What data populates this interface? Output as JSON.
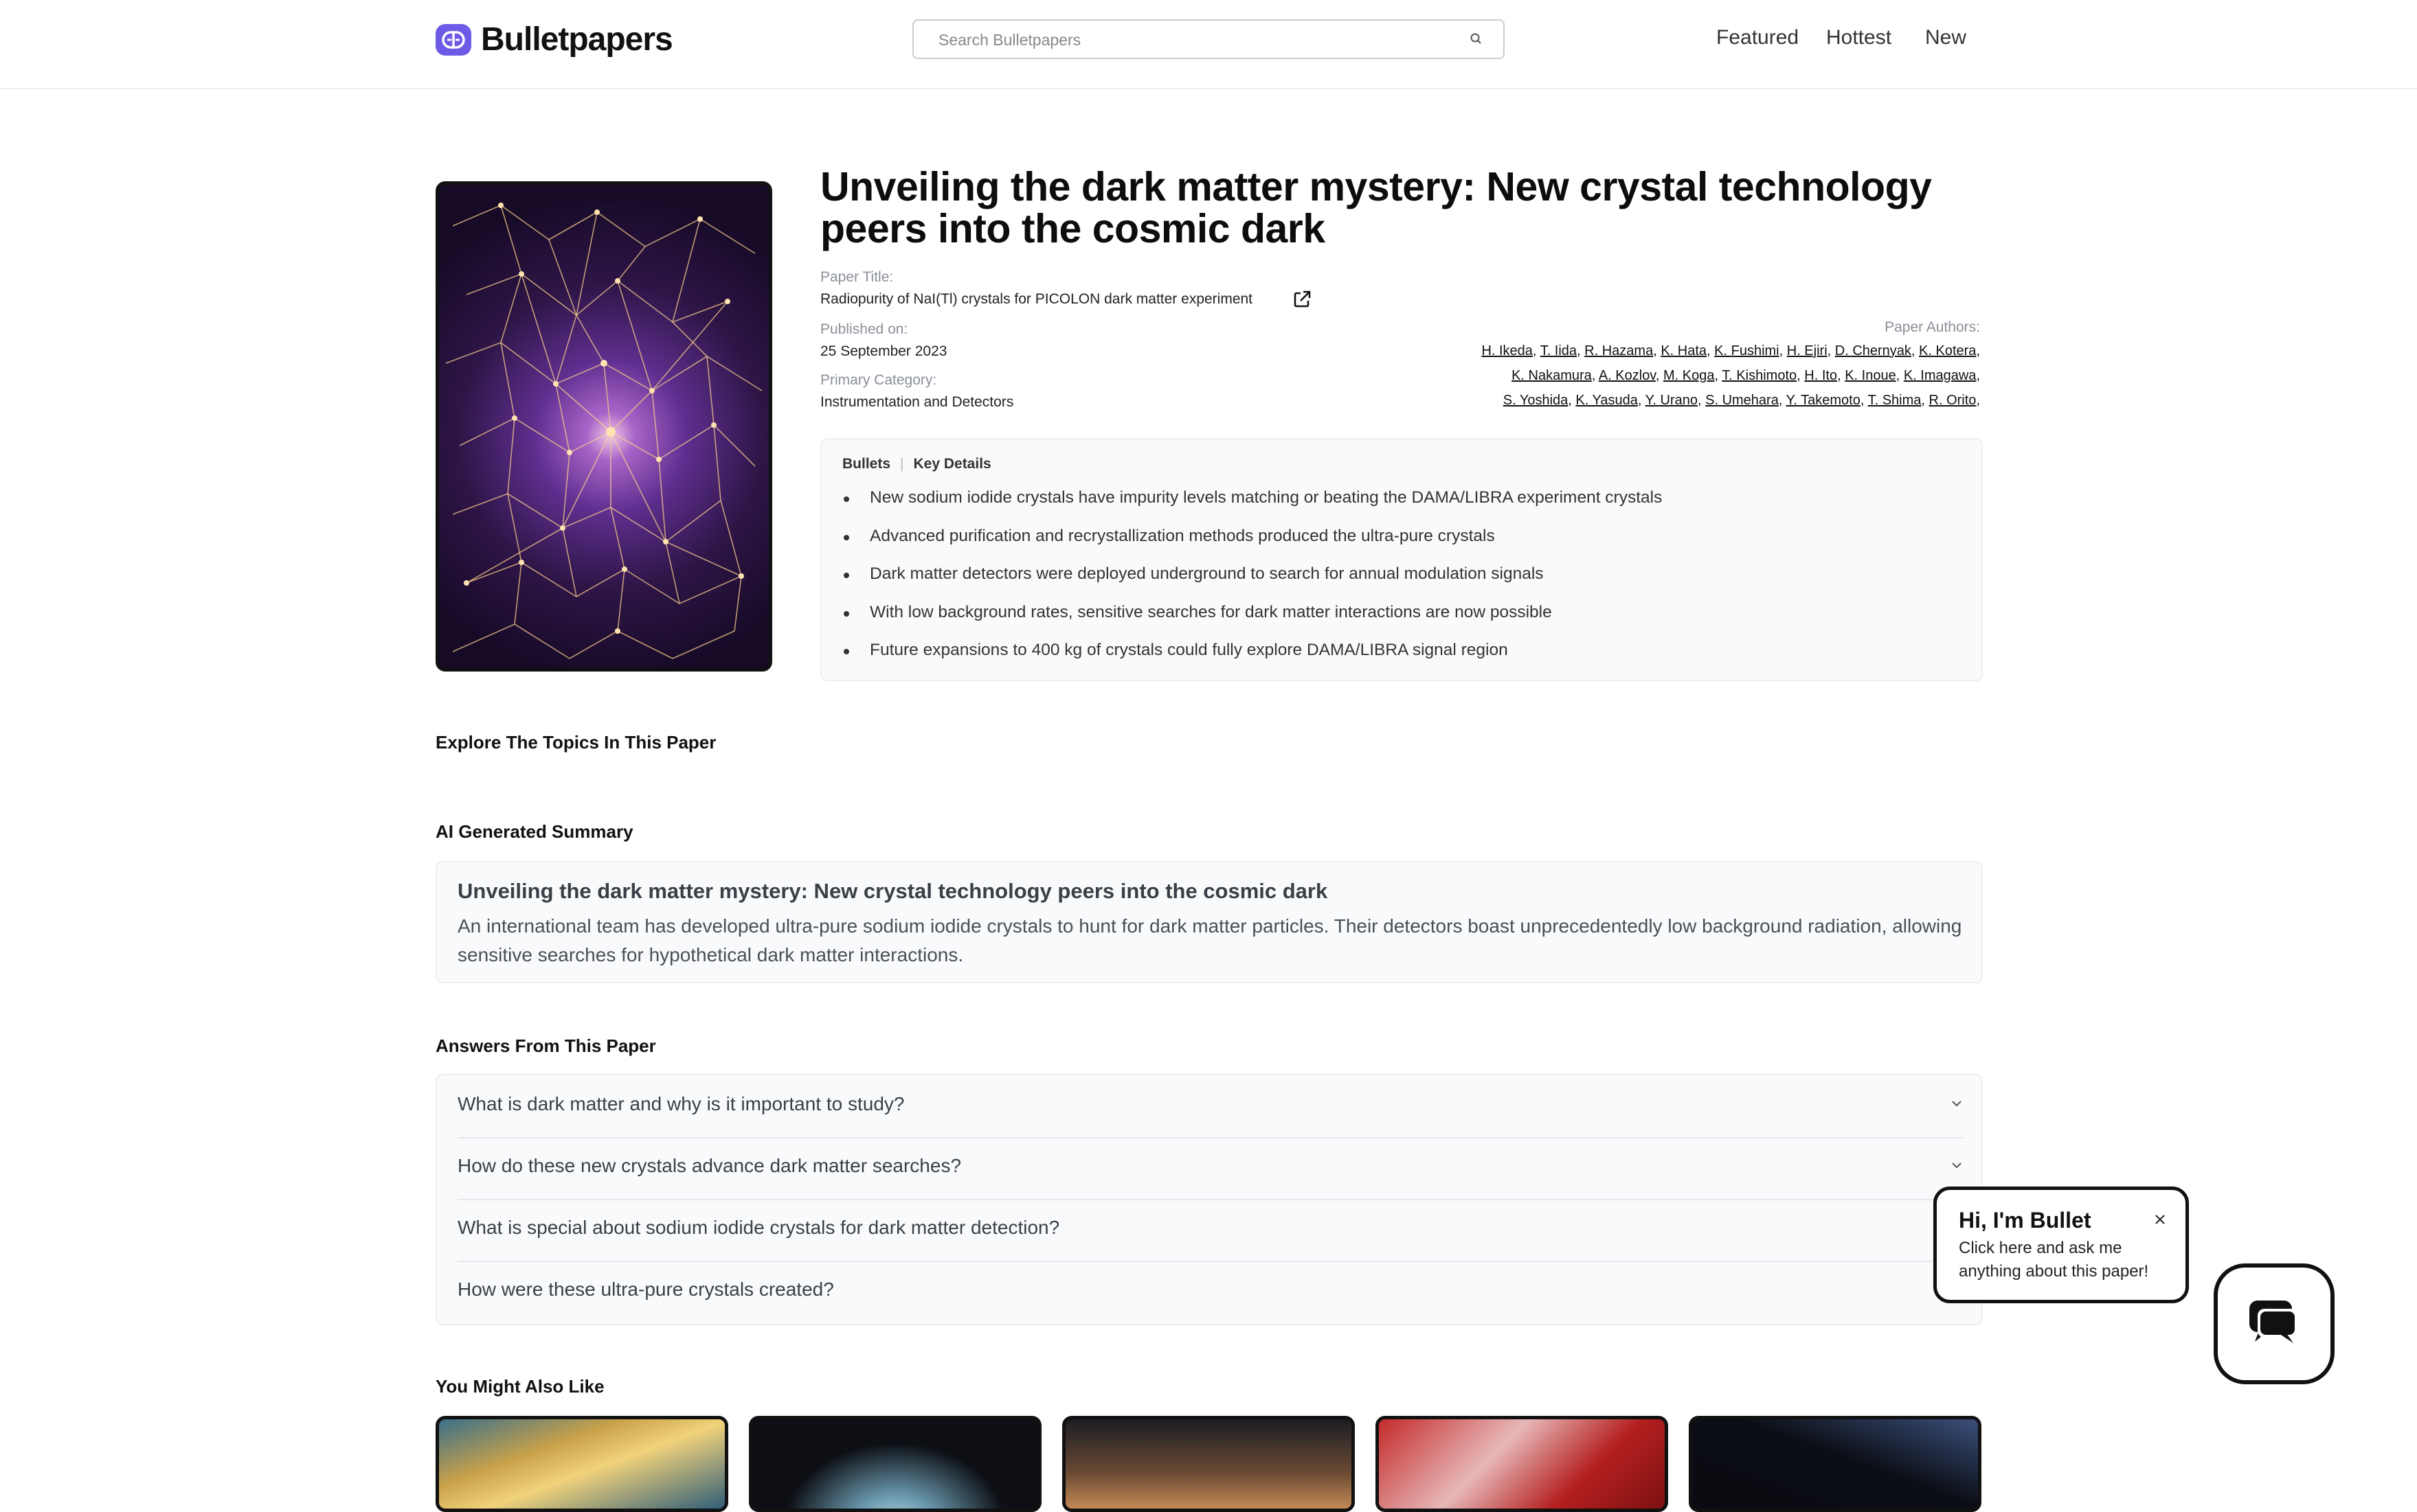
{
  "header": {
    "brand": "Bulletpapers",
    "search_placeholder": "Search Bulletpapers",
    "nav": [
      "Featured",
      "Hottest",
      "New"
    ]
  },
  "paper": {
    "headline": "Unveiling the dark matter mystery: New crystal technology peers into the cosmic dark",
    "title_label": "Paper Title:",
    "title": "Radiopurity of NaI(Tl) crystals for PICOLON dark matter experiment",
    "published_label": "Published on:",
    "published": "25 September 2023",
    "category_label": "Primary Category:",
    "category": "Instrumentation and Detectors",
    "authors_label": "Paper Authors:",
    "authors_lines": [
      [
        "H. Ikeda",
        "T. Iida",
        "R. Hazama",
        "K. Hata",
        "K. Fushimi",
        "H. Ejiri",
        "D. Chernyak",
        "K. Kotera"
      ],
      [
        "K. Nakamura",
        "A. Kozlov",
        "M. Koga",
        "T. Kishimoto",
        "H. Ito",
        "K. Inoue",
        "K. Imagawa"
      ],
      [
        "S. Yoshida",
        "K. Yasuda",
        "Y. Urano",
        "S. Umehara",
        "Y. Takemoto",
        "T. Shima",
        "R. Orito"
      ]
    ]
  },
  "bullets": {
    "tab_bullets": "Bullets",
    "tab_key_details": "Key Details",
    "items": [
      "New sodium iodide crystals have impurity levels matching or beating the DAMA/LIBRA experiment crystals",
      "Advanced purification and recrystallization methods produced the ultra-pure crystals",
      "Dark matter detectors were deployed underground to search for annual modulation signals",
      "With low background rates, sensitive searches for dark matter interactions are now possible",
      "Future expansions to 400 kg of crystals could fully explore DAMA/LIBRA signal region"
    ]
  },
  "sections": {
    "topics": "Explore The Topics In This Paper",
    "summary": "AI Generated Summary",
    "answers": "Answers From This Paper",
    "related": "You Might Also Like"
  },
  "summary": {
    "title": "Unveiling the dark matter mystery: New crystal technology peers into the cosmic dark",
    "body": "An international team has developed ultra-pure sodium iodide crystals to hunt for dark matter particles. Their detectors boast unprecedentedly low background radiation, allowing sensitive searches for hypothetical dark matter interactions."
  },
  "faq": [
    "What is dark matter and why is it important to study?",
    "How do these new crystals advance dark matter searches?",
    "What is special about sodium iodide crystals for dark matter detection?",
    "How were these ultra-pure crystals created?"
  ],
  "popup": {
    "title": "Hi, I'm Bullet",
    "body": "Click here and ask me anything about this paper!"
  },
  "colors": {
    "brand": "#6d5ae6",
    "text": "#111827",
    "card_bg": "#f9fafb"
  }
}
